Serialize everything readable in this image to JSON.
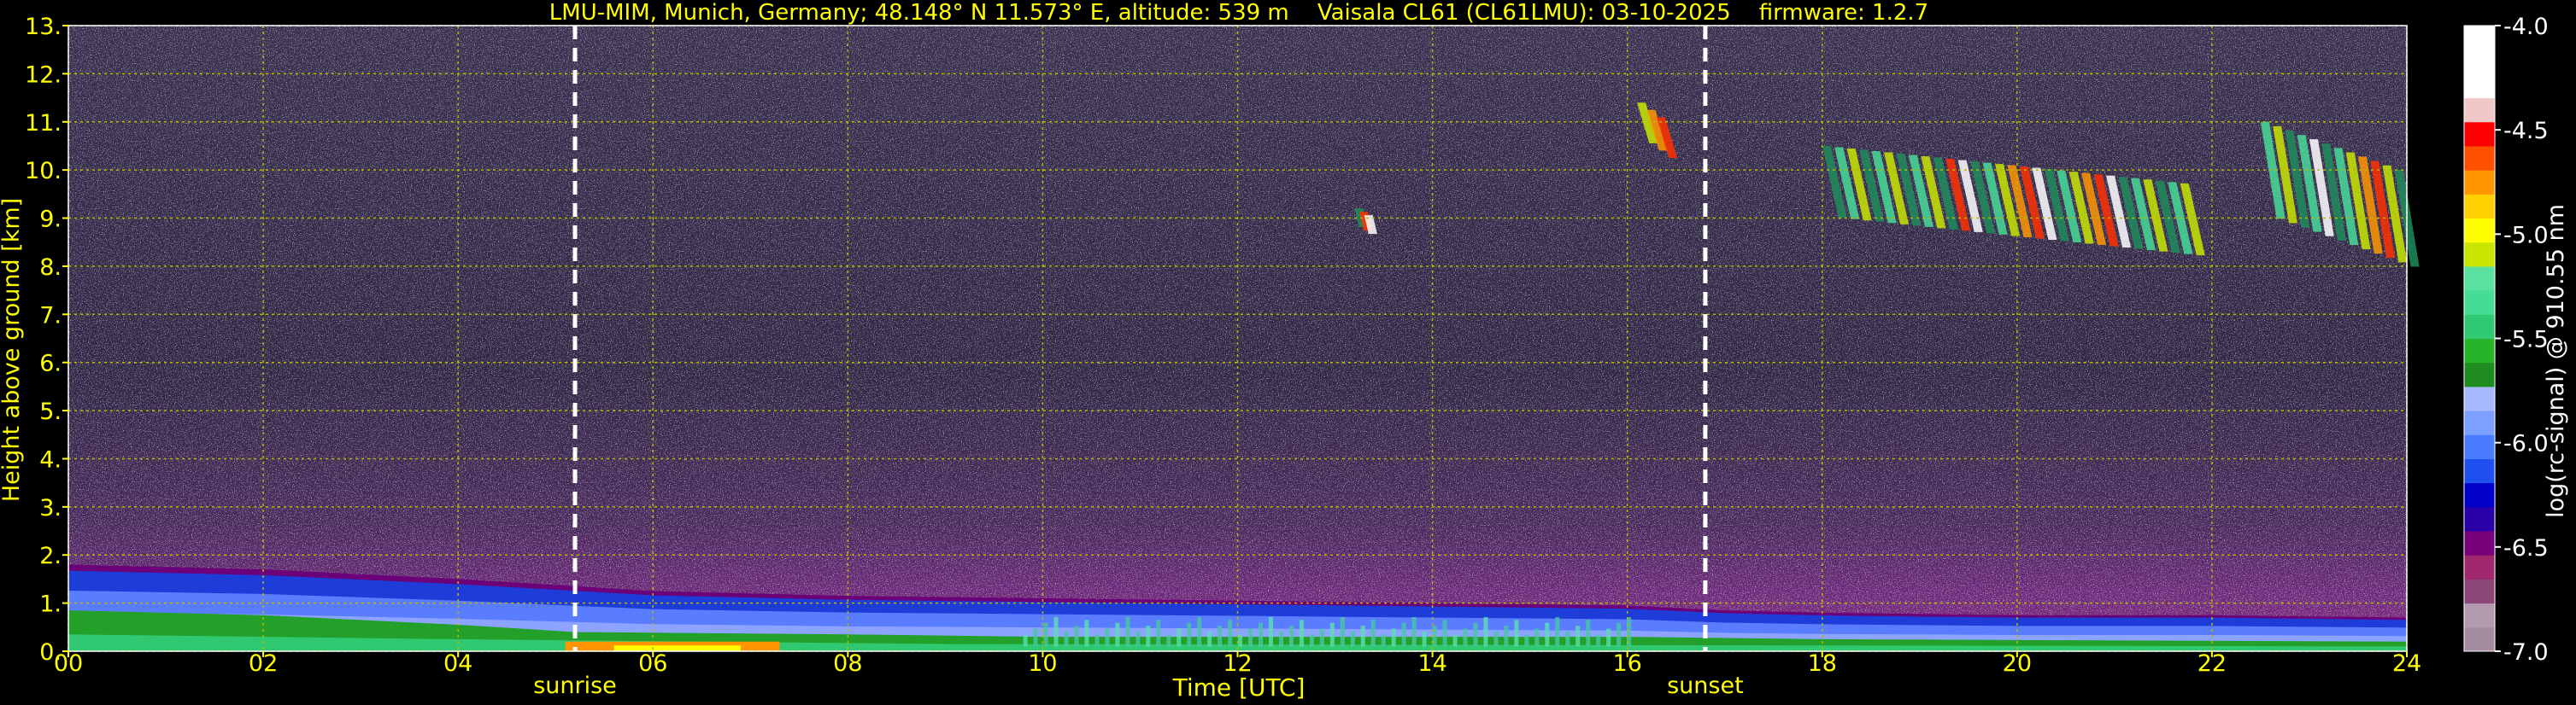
{
  "chart_data": {
    "type": "heatmap",
    "title": "LMU-MIM, Munich, Germany; 48.148° N 11.573° E, altitude: 539 m    Vaisala CL61 (CL61LMU): 03-10-2025    firmware: 1.2.7",
    "xlabel": "Time [UTC]",
    "ylabel": "Height above ground [km]",
    "xlim": [
      0,
      24
    ],
    "ylim": [
      0,
      13
    ],
    "x_ticks": [
      "00",
      "02",
      "04",
      "06",
      "08",
      "10",
      "12",
      "14",
      "16",
      "18",
      "20",
      "22",
      "24"
    ],
    "y_ticks": [
      "0.",
      "1.",
      "2.",
      "3.",
      "4.",
      "5.",
      "6.",
      "7.",
      "8.",
      "9.",
      "10.",
      "11.",
      "12.",
      "13."
    ],
    "grid": true,
    "grid_color": "#b8b800",
    "events": [
      {
        "label": "sunrise",
        "time": 5.2
      },
      {
        "label": "sunset",
        "time": 16.8
      }
    ],
    "colorbar": {
      "label": "log(rc-signal) @ 910.55 nm",
      "ticks": [
        "-4.0",
        "-4.5",
        "-5.0",
        "-5.5",
        "-6.0",
        "-6.5",
        "-7.0"
      ],
      "range": [
        -7.0,
        -4.0
      ],
      "colors": [
        "#a58ca0",
        "#b49aae",
        "#8c4678",
        "#a0286e",
        "#780078",
        "#2a00a8",
        "#0000c8",
        "#1e50f0",
        "#4a7cff",
        "#7ca0ff",
        "#a8b8ff",
        "#1e8c1e",
        "#28b428",
        "#30c870",
        "#46dc98",
        "#5ae0a0",
        "#c8e600",
        "#ffff00",
        "#ffd000",
        "#ff9600",
        "#ff5000",
        "#ff0000",
        "#f0c8c8",
        "#ffffff",
        "#ffffff",
        "#ffffff"
      ]
    },
    "boundary_layer_top": {
      "time": [
        0,
        2,
        4,
        5.2,
        6,
        8,
        10,
        12,
        14,
        16,
        17,
        18,
        20,
        22,
        24
      ],
      "height": [
        1.8,
        1.7,
        1.5,
        1.35,
        1.25,
        1.15,
        1.1,
        1.05,
        1.0,
        0.95,
        0.85,
        0.8,
        0.75,
        0.75,
        0.7
      ]
    },
    "cirrus_clouds": [
      {
        "time_start": 18.0,
        "time_end": 21.8,
        "base": 8.2,
        "top": 10.5,
        "max_signal": -4.0
      },
      {
        "time_start": 22.5,
        "time_end": 24.0,
        "base": 7.9,
        "top": 11.0,
        "max_signal": -4.5
      },
      {
        "time_start": 16.1,
        "time_end": 16.4,
        "base": 10.1,
        "top": 11.4,
        "max_signal": -5.5
      },
      {
        "time_start": 13.2,
        "time_end": 13.35,
        "base": 8.6,
        "top": 9.2,
        "max_signal": -4.5
      }
    ]
  }
}
